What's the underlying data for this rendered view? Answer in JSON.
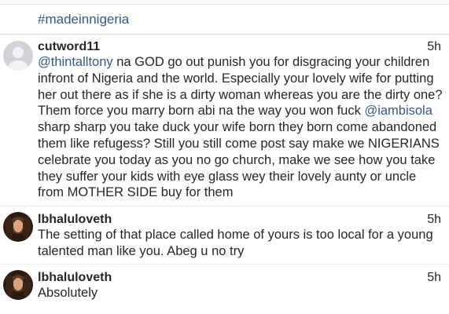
{
  "hashtag": "#madeinnigeria",
  "comments": [
    {
      "username": "cutword11",
      "time": "5h",
      "parts": [
        "@thintalltony",
        " na GOD go out punish you for disgracing your children infront of Nigeria and the world. Especially your lovely wife for putting her out there as if she is a dirty woman whereas you are the dirty one? Them force you marry born abi na the way you won fuck ",
        "@iambisola",
        " sharp sharp you take duck your wife born they born come abandoned them like refugess? Still you still come post say make we NIGERIANS celebrate you today as you no go church, make we see how you take they suffer your kids with eye glass wey their lovely aunty or uncle from MOTHER SIDE buy for them"
      ]
    },
    {
      "username": "lbhaluloveth",
      "time": "5h",
      "text": "The setting of that place called home of yours is too local for a young talented man like you. Abeg u no try"
    },
    {
      "username": "lbhaluloveth",
      "time": "5h",
      "text": "Absolutely"
    }
  ],
  "colors": {
    "link": "#34578a",
    "text": "#262626"
  }
}
